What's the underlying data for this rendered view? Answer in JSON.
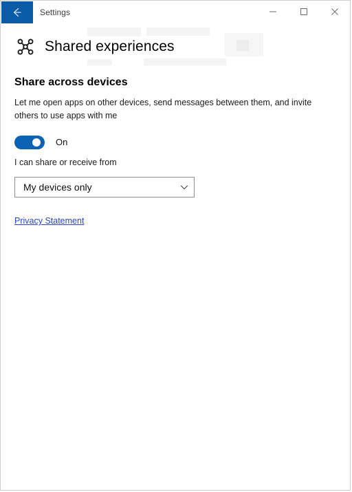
{
  "window": {
    "title": "Settings",
    "back_icon": "back-arrow-icon",
    "controls": [
      {
        "name": "minimize-button",
        "icon": "minimize-icon"
      },
      {
        "name": "maximize-button",
        "icon": "maximize-icon"
      },
      {
        "name": "close-button",
        "icon": "close-icon"
      }
    ]
  },
  "page": {
    "icon": "shared-experiences-icon",
    "title": "Shared experiences"
  },
  "section": {
    "heading": "Share across devices",
    "description": "Let me open apps on other devices, send messages between them, and invite others to use apps with me"
  },
  "toggle": {
    "state_label": "On",
    "checked": true,
    "icon": "toggle-switch-icon"
  },
  "device_scope": {
    "label": "I can share or receive from",
    "selected": "My devices only",
    "chevron_icon": "chevron-down-icon"
  },
  "links": {
    "privacy_statement": "Privacy Statement"
  },
  "colors": {
    "accent_blue": "#0a63b5",
    "back_button_blue": "#0a5ba8",
    "link_blue": "#2b44c7",
    "border_gray": "#8c8c8c"
  }
}
